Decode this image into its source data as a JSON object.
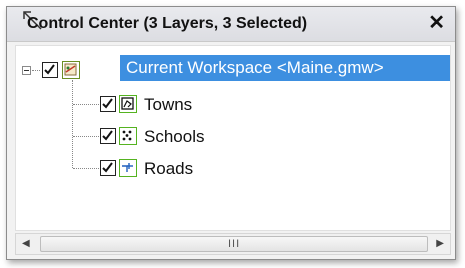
{
  "window": {
    "title": "Control Center (3 Layers, 3 Selected)",
    "close_glyph": "✕"
  },
  "workspace": {
    "label": "Current Workspace <Maine.gmw>",
    "checked": true,
    "expanded": true,
    "icon": "workspace-icon"
  },
  "layers": [
    {
      "label": "Towns",
      "checked": true,
      "icon": "polygon-layer-icon"
    },
    {
      "label": "Schools",
      "checked": true,
      "icon": "point-layer-icon"
    },
    {
      "label": "Roads",
      "checked": true,
      "icon": "line-layer-icon"
    }
  ],
  "scrollbar": {
    "left_arrow": "◀",
    "right_arrow": "▶",
    "grip": "III"
  },
  "colors": {
    "selection": "#3d8fe0",
    "layer_icon_border": "#55b320"
  }
}
